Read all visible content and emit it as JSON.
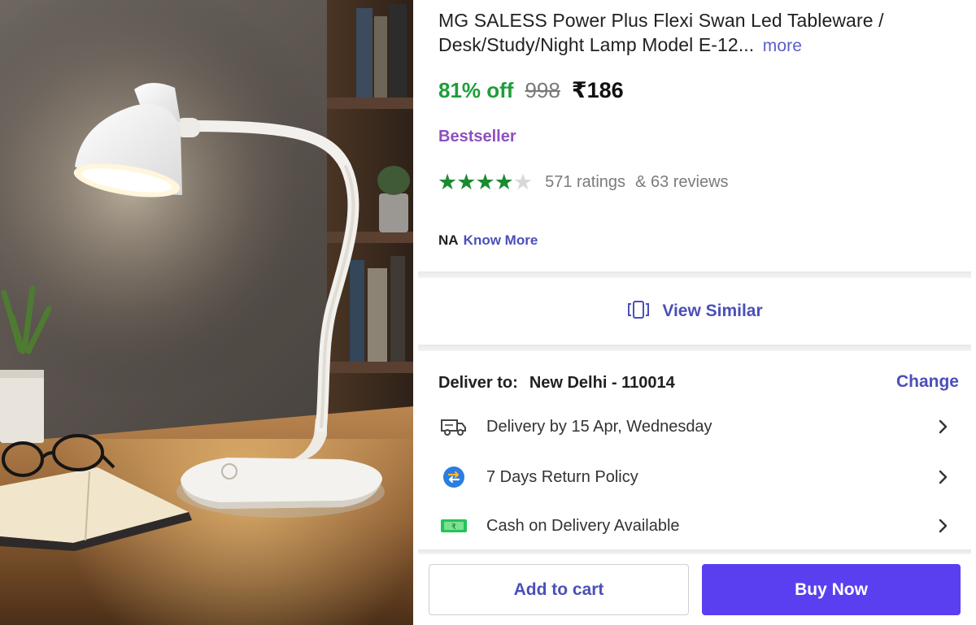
{
  "product": {
    "title": "MG SALESS Power Plus Flexi Swan Led Tableware / Desk/Study/Night Lamp Model E-12...",
    "more_label": "more",
    "discount": "81% off",
    "mrp": "998",
    "price": "₹186",
    "badge": "Bestseller",
    "rating_value": 4,
    "rating_max": 5,
    "ratings_count": "571 ratings",
    "reviews_count": "& 63 reviews",
    "na_text": "NA",
    "know_more_label": "Know More"
  },
  "view_similar": {
    "label": "View Similar",
    "icon": "view-similar-icon"
  },
  "delivery": {
    "deliver_to_label": "Deliver to:",
    "address": "New Delhi - 110014",
    "change_label": "Change",
    "rows": [
      {
        "icon": "truck-icon",
        "text": "Delivery by 15 Apr, Wednesday"
      },
      {
        "icon": "return-icon",
        "text": "7 Days Return Policy"
      },
      {
        "icon": "cash-icon",
        "text": "Cash on Delivery Available"
      }
    ]
  },
  "actions": {
    "add_to_cart": "Add to cart",
    "buy_now": "Buy Now"
  },
  "colors": {
    "accent": "#4b4fb8",
    "buy_button": "#5a3ff0",
    "discount": "#1f9d3a",
    "star": "#1b8a32",
    "bestseller": "#8e4fbf"
  }
}
